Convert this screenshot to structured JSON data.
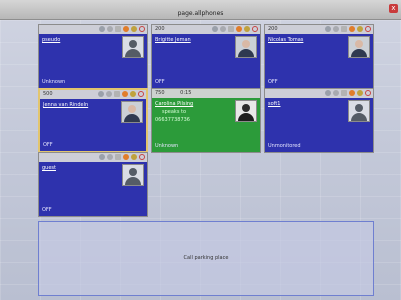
{
  "window": {
    "title": "page.allphones",
    "close_glyph": "x"
  },
  "cards": [
    {
      "ext": "",
      "time": "",
      "name": "pseudo",
      "status": "Unknown",
      "avatar": "person-silhouette"
    },
    {
      "ext": "200",
      "time": "",
      "name": "Brigitte Jeman",
      "status": "OFF",
      "avatar": "person-photo"
    },
    {
      "ext": "200",
      "time": "",
      "name": "Nicolas Tomas",
      "status": "OFF",
      "avatar": "person-photo"
    },
    {
      "ext": "500",
      "time": "",
      "name": "Jenna van Rindeln",
      "status": "OFF",
      "avatar": "person-photo"
    },
    {
      "ext": "750",
      "time": "0:15",
      "name": "Carolina Pilsing",
      "line2": "speaks to",
      "line3": "06637738736",
      "status": "Unknown",
      "avatar": "person-photo"
    },
    {
      "ext": "",
      "time": "",
      "name": "soft1",
      "status": "Unmonitored",
      "avatar": "person-silhouette"
    },
    {
      "ext": "",
      "time": "",
      "name": "guest",
      "status": "OFF",
      "avatar": "person-silhouette"
    }
  ],
  "parking": {
    "label": "Call parking place"
  },
  "colors": {
    "card_blue": "#2e32ad",
    "card_green": "#2c9b3a",
    "selected_border": "#e2c56e"
  },
  "icons": [
    "phone-icon",
    "mute-icon",
    "forward-icon",
    "fire-icon",
    "settings-icon",
    "ring-icon",
    "close-icon"
  ]
}
